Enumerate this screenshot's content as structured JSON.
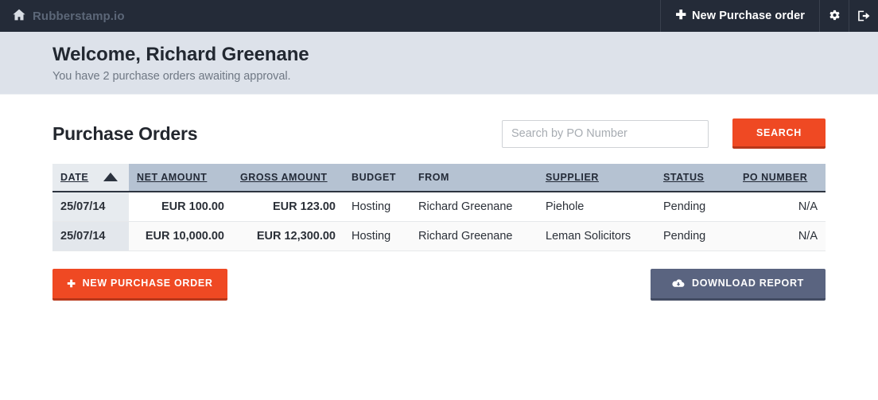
{
  "topbar": {
    "brand": "Rubberstamp.io",
    "brand_icon": "home-icon",
    "new_po_label": "New Purchase order",
    "new_po_plus": "✚",
    "settings_icon": "gear-icon",
    "logout_icon": "sign-out-icon"
  },
  "banner": {
    "welcome": "Welcome, Richard Greenane",
    "subtitle": "You have 2 purchase orders awaiting approval."
  },
  "main": {
    "title": "Purchase Orders",
    "search": {
      "placeholder": "Search by PO Number",
      "value": "",
      "button_label": "SEARCH"
    },
    "table": {
      "columns": [
        {
          "label": "DATE",
          "sortable": true,
          "sorted": true,
          "sort_dir": "asc",
          "align": "left"
        },
        {
          "label": "NET AMOUNT",
          "sortable": true,
          "sorted": false,
          "align": "right"
        },
        {
          "label": "GROSS AMOUNT",
          "sortable": true,
          "sorted": false,
          "align": "right"
        },
        {
          "label": "BUDGET",
          "sortable": false,
          "sorted": false,
          "align": "left"
        },
        {
          "label": "FROM",
          "sortable": false,
          "sorted": false,
          "align": "left"
        },
        {
          "label": "SUPPLIER",
          "sortable": true,
          "sorted": false,
          "align": "left"
        },
        {
          "label": "STATUS",
          "sortable": true,
          "sorted": false,
          "align": "left"
        },
        {
          "label": "PO NUMBER",
          "sortable": true,
          "sorted": false,
          "align": "right"
        }
      ],
      "rows": [
        {
          "date": "25/07/14",
          "net_amount": "EUR 100.00",
          "gross_amount": "EUR 123.00",
          "budget": "Hosting",
          "from": "Richard Greenane",
          "supplier": "Piehole",
          "status": "Pending",
          "po_number": "N/A"
        },
        {
          "date": "25/07/14",
          "net_amount": "EUR 10,000.00",
          "gross_amount": "EUR 12,300.00",
          "budget": "Hosting",
          "from": "Richard Greenane",
          "supplier": "Leman Solicitors",
          "status": "Pending",
          "po_number": "N/A"
        }
      ]
    },
    "footer": {
      "new_po_label": "NEW PURCHASE ORDER",
      "new_po_plus": "✚",
      "download_label": "DOWNLOAD REPORT",
      "download_icon": "cloud-download-icon"
    }
  },
  "colors": {
    "topbar_bg": "#242b38",
    "banner_bg": "#dde2ea",
    "accent_orange": "#ef4923",
    "date_text_orange": "#ef7a42",
    "table_header_bg": "#b5c2d2",
    "slate_button": "#5a6480"
  }
}
